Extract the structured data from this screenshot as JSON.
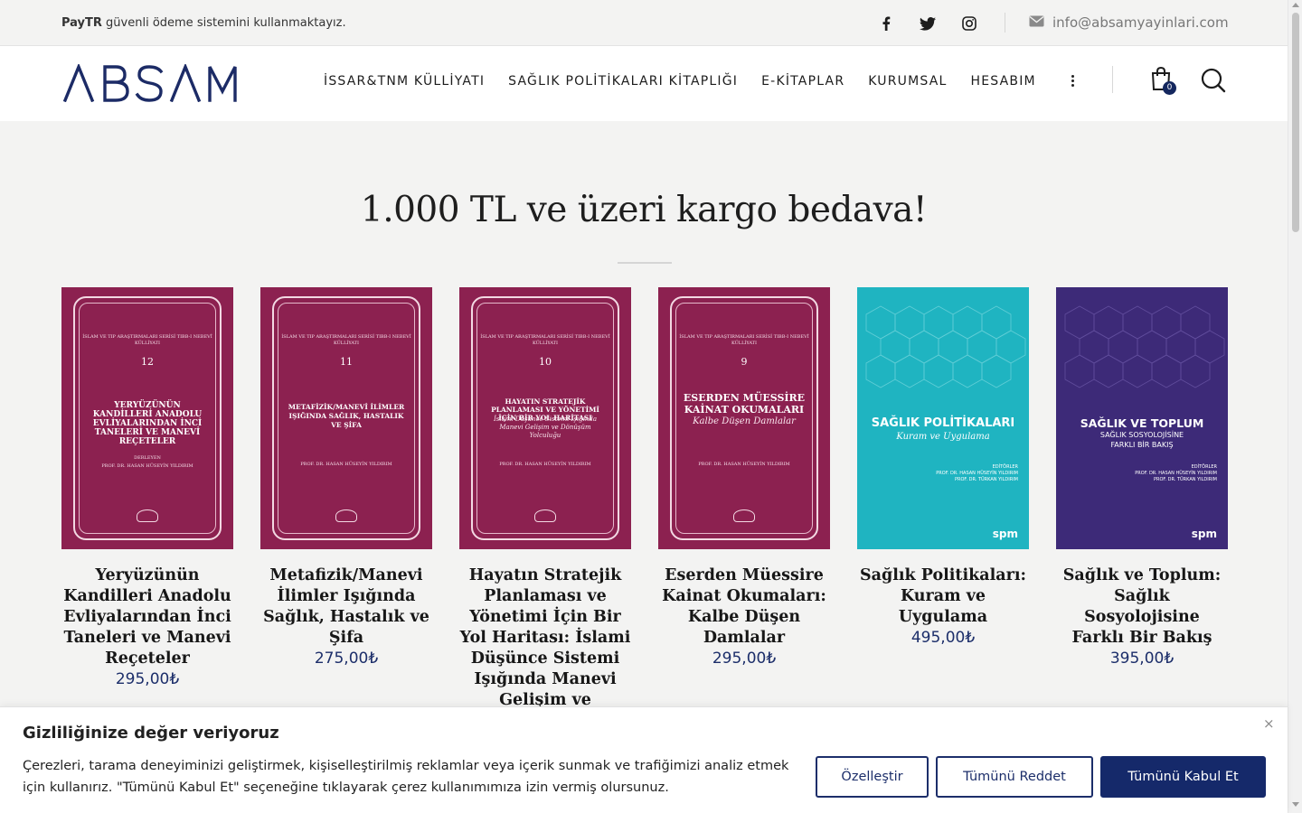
{
  "topbar": {
    "secure_brand": "PayTR",
    "secure_text": " güvenli ödeme sistemini kullanmaktayız.",
    "socials": [
      "facebook-icon",
      "twitter-icon",
      "instagram-icon"
    ],
    "email": "info@absamyayinlari.com"
  },
  "header": {
    "logo": "ABSAM",
    "nav": [
      {
        "label": "İSSAR&TNM KÜLLİYATI"
      },
      {
        "label": "SAĞLIK POLİTİKALARI KİTAPLIĞI"
      },
      {
        "label": "E-KİTAPLAR"
      },
      {
        "label": "KURUMSAL"
      },
      {
        "label": "HESABIM"
      }
    ],
    "cart_count": "0"
  },
  "main": {
    "headline": "1.000 TL ve üzeri kargo bedava!",
    "products": [
      {
        "title": "Yeryüzünün Kandilleri Anadolu Evliyalarından İnci Taneleri ve Manevi Reçeteler",
        "price": "295,00₺",
        "cover": {
          "series": "İSLAM VE TIP ARAŞTIRMALARI SERİSİ TIBB-I NEBEVÎ KÜLLİYATI",
          "number": "12",
          "title": "YERYÜZÜNÜN KANDİLLERİ ANADOLU EVLİYALARINDAN İNCİ TANELERİ VE MANEVİ REÇETELER",
          "editor": "DERLEYEN",
          "author": "PROF. DR. HASAN HÜSEYİN YILDIRIM",
          "publisher": "TNMKİTAP"
        }
      },
      {
        "title": "Metafizik/Manevi İlimler Işığında Sağlık, Hastalık ve Şifa",
        "price": "275,00₺",
        "cover": {
          "series": "İSLAM VE TIP ARAŞTIRMALARI SERİSİ TIBB-I NEBEVÎ KÜLLİYATI",
          "number": "11",
          "title": "METAFİZİK/MANEVİ İLİMLER IŞIĞINDA SAĞLIK, HASTALIK VE ŞİFA",
          "author": "PROF. DR. HASAN HÜSEYİN YILDIRIM",
          "publisher": "TNMKİTAP"
        }
      },
      {
        "title": "Hayatın Stratejik Planlaması ve Yönetimi İçin Bir Yol Haritası: İslami Düşünce Sistemi Işığında Manevi Gelişim ve Dönüşüm",
        "price": "",
        "cover": {
          "series": "İSLAM VE TIP ARAŞTIRMALARI SERİSİ TIBB-I NEBEVÎ KÜLLİYATI",
          "number": "10",
          "title": "HAYATIN STRATEJİK PLANLAMASI VE YÖNETİMİ İÇİN BİR YOL HARİTASI",
          "subtitle": "İslami Düşünce Sistemi Işığında Manevi Gelişim ve Dönüşüm Yolculuğu",
          "author": "PROF. DR. HASAN HÜSEYİN YILDIRIM",
          "publisher": "TNMKİTAP"
        }
      },
      {
        "title": "Eserden Müessire Kainat Okumaları: Kalbe Düşen Damlalar",
        "price": "295,00₺",
        "cover": {
          "series": "İSLAM VE TIP ARAŞTIRMALARI SERİSİ TIBB-I NEBEVÎ KÜLLİYATI",
          "number": "9",
          "title": "ESERDEN MÜESSİRE KAİNAT OKUMALARI",
          "subtitle": "Kalbe Düşen Damlalar",
          "author": "PROF. DR. HASAN HÜSEYİN YILDIRIM",
          "publisher": "TNMKİTAP"
        }
      },
      {
        "title": "Sağlık Politikaları: Kuram ve Uygulama",
        "price": "495,00₺",
        "cover": {
          "title": "SAĞLIK POLİTİKALARI",
          "subtitle": "Kuram ve Uygulama",
          "editors_label": "EDİTÖRLER",
          "editor1": "PROF. DR. HASAN HÜSEYİN YILDIRIM",
          "editor2": "PROF. DR. TÜRKAN YILDIRIM",
          "publisher": "spm"
        }
      },
      {
        "title": "Sağlık ve Toplum: Sağlık Sosyolojisine Farklı Bir Bakış",
        "price": "395,00₺",
        "cover": {
          "title": "SAĞLIK VE TOPLUM",
          "subtitle": "SAĞLIK SOSYOLOJİSİNE FARKLI BİR BAKIŞ",
          "editors_label": "EDİTÖRLER",
          "editor1": "PROF. DR. HASAN HÜSEYİN YILDIRIM",
          "editor2": "PROF. DR. TÜRKAN YILDIRIM",
          "publisher": "spm"
        }
      }
    ]
  },
  "cookie": {
    "title": "Gizliliğinize değer veriyoruz",
    "text": "Çerezleri, tarama deneyiminizi geliştirmek, kişiselleştirilmiş reklamlar veya içerik sunmak ve trafiğimizi analiz etmek için kullanırız. \"Tümünü Kabul Et\" seçeneğine tıklayarak çerez kullanımımıza izin vermiş olursunuz.",
    "customize": "Özelleştir",
    "reject": "Tümünü Reddet",
    "accept": "Tümünü Kabul Et",
    "close": "×"
  },
  "colors": {
    "brand_navy": "#15296a",
    "price_blue": "#1c2e6a",
    "cover_red": "#8c2150",
    "cover_teal": "#1fb4c1",
    "cover_purple": "#3d2a78"
  }
}
